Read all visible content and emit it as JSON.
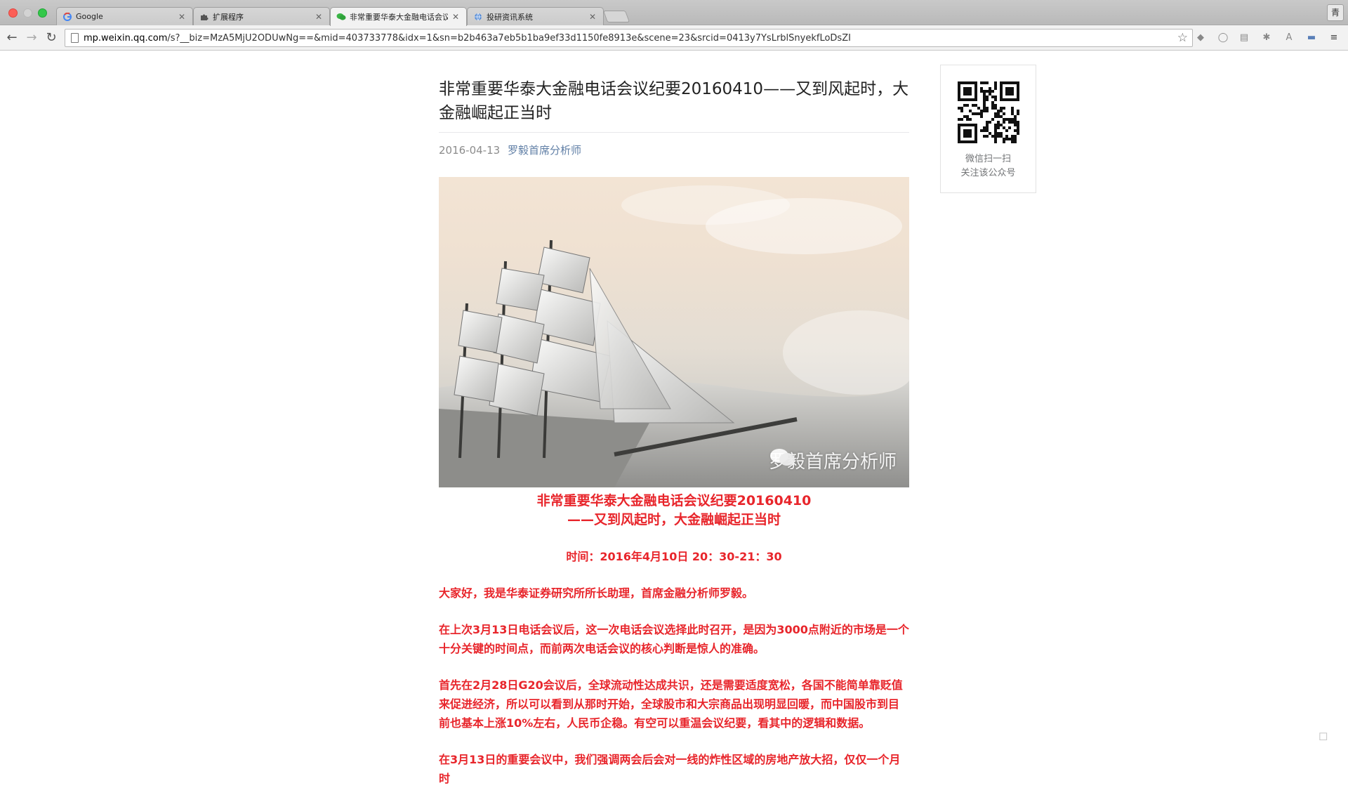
{
  "browser": {
    "tabs": [
      {
        "title": "Google",
        "icon": "google-icon",
        "active": false
      },
      {
        "title": "扩展程序",
        "icon": "puzzle-icon",
        "active": false
      },
      {
        "title": "非常重要华泰大金融电话会议",
        "icon": "wechat-icon",
        "active": true
      },
      {
        "title": "投研资讯系统",
        "icon": "globe-icon",
        "active": false
      }
    ],
    "profile_label": "青",
    "url_host": "mp.weixin.qq.com",
    "url_path": "/s?__biz=MzA5MjU2ODUwNg==&mid=403733778&idx=1&sn=b2b463a7eb5b1ba9ef33d1150fe8913e&scene=23&srcid=0413y7YsLrblSnyekfLoDsZI"
  },
  "article": {
    "title": "非常重要华泰大金融电话会议纪要20160410——又到风起时，大金融崛起正当时",
    "date": "2016-04-13",
    "author": "罗毅首席分析师",
    "image_watermark": "罗毅首席分析师",
    "subtitle_line1": "非常重要华泰大金融电话会议纪要20160410",
    "subtitle_line2": "——又到风起时，大金融崛起正当时",
    "time_line": "时间：2016年4月10日 20：30-21：30",
    "paragraphs": [
      "大家好，我是华泰证券研究所所长助理，首席金融分析师罗毅。",
      "在上次3月13日电话会议后，这一次电话会议选择此时召开，是因为3000点附近的市场是一个十分关键的时间点，而前两次电话会议的核心判断是惊人的准确。",
      "首先在2月28日G20会议后，全球流动性达成共识，还是需要适度宽松，各国不能简单靠贬值来促进经济，所以可以看到从那时开始，全球股市和大宗商品出现明显回暖，而中国股市到目前也基本上涨10%左右，人民币企稳。有空可以重温会议纪要，看其中的逻辑和数据。",
      "在3月13日的重要会议中，我们强调两会后会对一线的炸性区域的房地产放大招，仅仅一个月时"
    ]
  },
  "qr_card": {
    "caption_line1": "微信扫一扫",
    "caption_line2": "关注该公众号"
  },
  "colors": {
    "accent_red": "#e8252b",
    "author_link": "#607fa6"
  }
}
